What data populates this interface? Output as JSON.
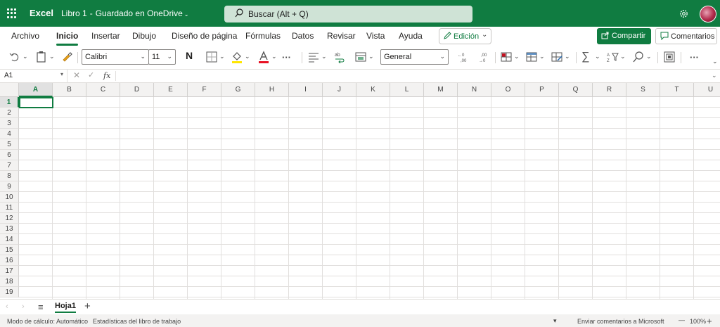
{
  "titlebar": {
    "app_name": "Excel",
    "doc_name": "Libro 1",
    "doc_separator": "-",
    "doc_status": "Guardado en OneDrive",
    "search_placeholder": "Buscar (Alt + Q)"
  },
  "menu": {
    "tabs": [
      "Archivo",
      "Inicio",
      "Insertar",
      "Dibujo",
      "Diseño de página",
      "Fórmulas",
      "Datos",
      "Revisar",
      "Vista",
      "Ayuda"
    ],
    "active_tab": "Inicio",
    "edit_mode": "Edición",
    "share_label": "Compartir",
    "comments_label": "Comentarios"
  },
  "ribbon": {
    "font_name": "Calibri",
    "font_size": "11",
    "bold_label": "N",
    "number_format": "General",
    "more_label": "···"
  },
  "formula_bar": {
    "name_box": "A1",
    "fx_label": "fx",
    "content": ""
  },
  "grid": {
    "columns": [
      "A",
      "B",
      "C",
      "D",
      "E",
      "F",
      "G",
      "H",
      "I",
      "J",
      "K",
      "L",
      "M",
      "N",
      "O",
      "P",
      "Q",
      "R",
      "S",
      "T",
      "U"
    ],
    "rows": [
      "1",
      "2",
      "3",
      "4",
      "5",
      "6",
      "7",
      "8",
      "9",
      "10",
      "11",
      "12",
      "13",
      "14",
      "15",
      "16",
      "17",
      "18",
      "19"
    ],
    "active_cell": "A1"
  },
  "sheets": {
    "tabs": [
      "Hoja1"
    ],
    "active": "Hoja1",
    "add_label": "+"
  },
  "status": {
    "calc_mode": "Modo de cálculo: Automático",
    "workbook_stats": "Estadísticas del libro de trabajo",
    "feedback": "Enviar comentarios a Microsoft",
    "zoom_minus": "—",
    "zoom_level": "100%",
    "zoom_plus": "+"
  },
  "colors": {
    "brand": "#107c41",
    "search_bg": "#cfe3d6"
  }
}
